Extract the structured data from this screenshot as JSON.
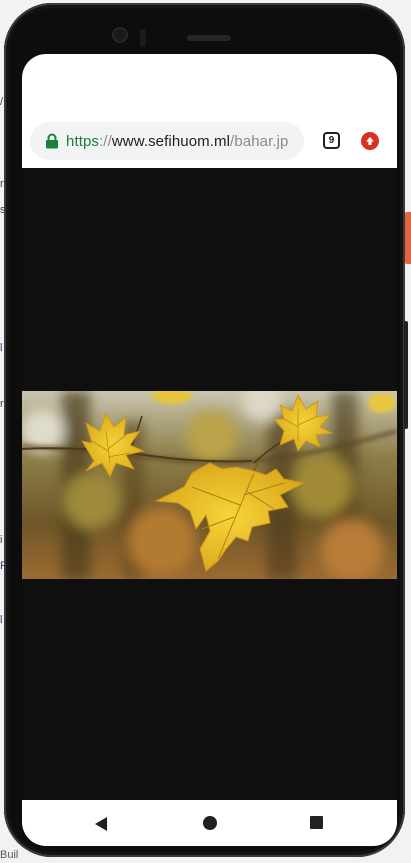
{
  "browser": {
    "url": {
      "scheme": "https",
      "separator": "://",
      "host": "www.sefihuom.ml",
      "path": "/bahar.jp"
    },
    "tab_count": "9",
    "icons": {
      "lock": "lock-icon",
      "tabs": "tab-switcher-icon",
      "update": "update-arrow-icon"
    },
    "colors": {
      "secure_scheme": "#188038",
      "update_badge": "#d93025",
      "viewer_background": "#0f0f0f"
    }
  },
  "content": {
    "image": {
      "subject": "yellow maple leaves photo"
    }
  },
  "navigation": {
    "icons": {
      "back": "back-triangle-icon",
      "home": "home-circle-icon",
      "recents": "recents-square-icon"
    }
  },
  "background_page": {
    "footer_text": "Buil"
  }
}
